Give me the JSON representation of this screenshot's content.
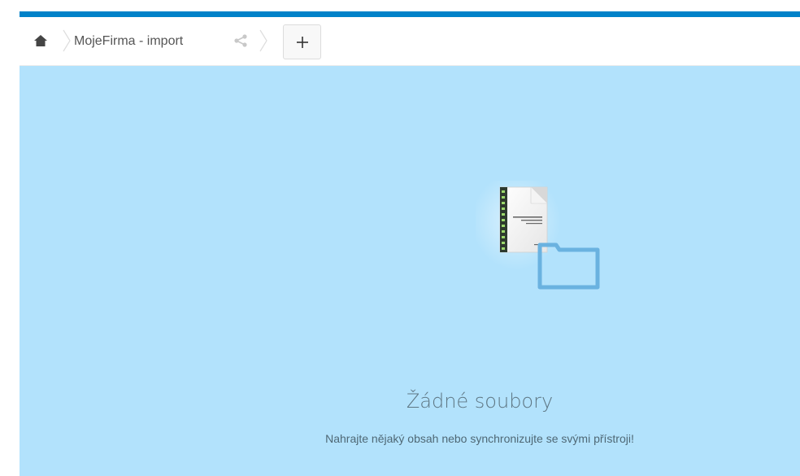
{
  "breadcrumb": {
    "home_icon": "home-icon",
    "folder_name": "MojeFirma - import",
    "share_icon": "share-icon"
  },
  "toolbar": {
    "new_label": "+"
  },
  "empty_state": {
    "title": "Žádné soubory",
    "description": "Nahrajte nějaký obsah nebo synchronizujte se svými přístroji!",
    "illustration_icon": "folder-with-document-icon"
  },
  "colors": {
    "accent": "#0082c9",
    "content_background": "#b2e2fc",
    "folder_outline": "#6ab2e0"
  }
}
